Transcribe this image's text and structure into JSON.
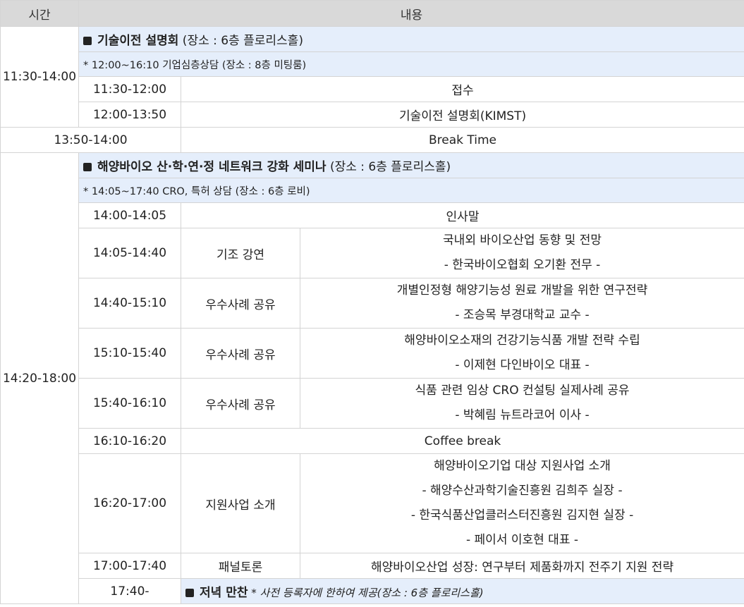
{
  "header": {
    "time": "시간",
    "content": "내용"
  },
  "block1": {
    "time": "11:30-14:00",
    "title": "기술이전 설명회",
    "place": " (장소 : 6층 플로리스홀)",
    "note": "* 12:00~16:10 기업심층상담 (장소 : 8층 미팅룸)",
    "rows": [
      {
        "time": "11:30-12:00",
        "content": "접수"
      },
      {
        "time": "12:00-13:50",
        "content": "기술이전 설명회(KIMST)"
      }
    ]
  },
  "break1": {
    "time": "13:50-14:00",
    "content": "Break Time"
  },
  "block2": {
    "time": "14:20-18:00",
    "title": "해양바이오 산·학·연·정 네트워크 강화 세미나",
    "place": "  (장소 : 6층 플로리스홀)",
    "note": "* 14:05~17:40 CRO, 특허 상담 (장소 : 6층 로비)",
    "greeting": {
      "time": "14:00-14:05",
      "content": "인사말"
    },
    "sessions": [
      {
        "time": "14:05-14:40",
        "type": "기조 강연",
        "lines": [
          "국내외 바이오산업 동향 및 전망",
          "- 한국바이오협회 오기환 전무 -"
        ]
      },
      {
        "time": "14:40-15:10",
        "type": "우수사례 공유",
        "lines": [
          "개별인정형 해양기능성 원료 개발을 위한 연구전략",
          "- 조승목 부경대학교 교수 -"
        ]
      },
      {
        "time": "15:10-15:40",
        "type": "우수사례 공유",
        "lines": [
          "해양바이오소재의 건강기능식품 개발 전략 수립",
          "- 이제현 다인바이오 대표 -"
        ]
      }
    ],
    "session4": {
      "time": "15:40-16:10",
      "type": "우수사례 공유",
      "lines": [
        "식품 관련 임상 CRO 컨설팅 실제사례 공유",
        "- 박혜림 뉴트라코어 이사 -"
      ]
    },
    "coffee": {
      "time": "16:10-16:20",
      "content": "Coffee break"
    },
    "support": {
      "time": "16:20-17:00",
      "type": "지원사업 소개",
      "lines": [
        "해양바이오기업 대상 지원사업 소개",
        "- 해양수산과학기술진흥원 김희주 실장 -",
        "- 한국식품산업클러스터진흥원 김지현 실장 -",
        "- 페이서 이호현 대표 -"
      ]
    },
    "panel": {
      "time": "17:00-17:40",
      "type": "패널토론",
      "content": "해양바이오산업 성장: 연구부터 제품화까지 전주기 지원 전략"
    }
  },
  "dinner": {
    "time": "17:40-",
    "title": "저녁 만찬",
    "note": " * 사전 등록자에 한하여 제공(장소 : 6층 플로리스홀)"
  }
}
